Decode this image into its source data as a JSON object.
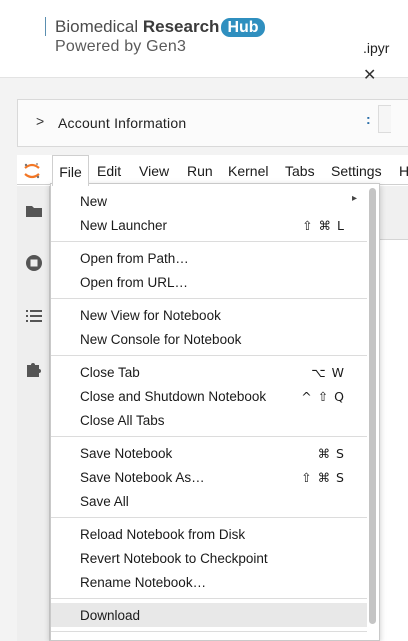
{
  "header": {
    "brand_regular": "Biomedical ",
    "brand_bold": "Research",
    "brand_badge": "Hub",
    "subtitle": "Powered by Gen3"
  },
  "account": {
    "chevron": ">",
    "label": "Account Information"
  },
  "menubar": {
    "items": [
      "File",
      "Edit",
      "View",
      "Run",
      "Kernel",
      "Tabs",
      "Settings",
      "H"
    ]
  },
  "notebook": {
    "tab_fragment": ".ipyr",
    "close_glyph": "✕",
    "prompt_glyph": ":"
  },
  "file_menu": {
    "items": [
      {
        "label": "New",
        "shortcut": "",
        "submenu_glyph": "▸"
      },
      {
        "label": "New Launcher",
        "shortcut": "⇧ ⌘ L"
      },
      {
        "label": "Open from Path…",
        "shortcut": ""
      },
      {
        "label": "Open from URL…",
        "shortcut": ""
      },
      {
        "label": "New View for Notebook",
        "shortcut": ""
      },
      {
        "label": "New Console for Notebook",
        "shortcut": ""
      },
      {
        "label": "Close Tab",
        "shortcut": "⌥ W"
      },
      {
        "label": "Close and Shutdown Notebook",
        "shortcut": "^ ⇧ Q"
      },
      {
        "label": "Close All Tabs",
        "shortcut": ""
      },
      {
        "label": "Save Notebook",
        "shortcut": "⌘ S"
      },
      {
        "label": "Save Notebook As…",
        "shortcut": "⇧ ⌘ S"
      },
      {
        "label": "Save All",
        "shortcut": ""
      },
      {
        "label": "Reload Notebook from Disk",
        "shortcut": ""
      },
      {
        "label": "Revert Notebook to Checkpoint",
        "shortcut": ""
      },
      {
        "label": "Rename Notebook…",
        "shortcut": ""
      },
      {
        "label": "Download",
        "shortcut": "",
        "highlighted": true
      }
    ]
  },
  "colors": {
    "badge": "#2f8fbf",
    "accent_orange": "#f37726",
    "highlight": "#e8e8e8"
  }
}
